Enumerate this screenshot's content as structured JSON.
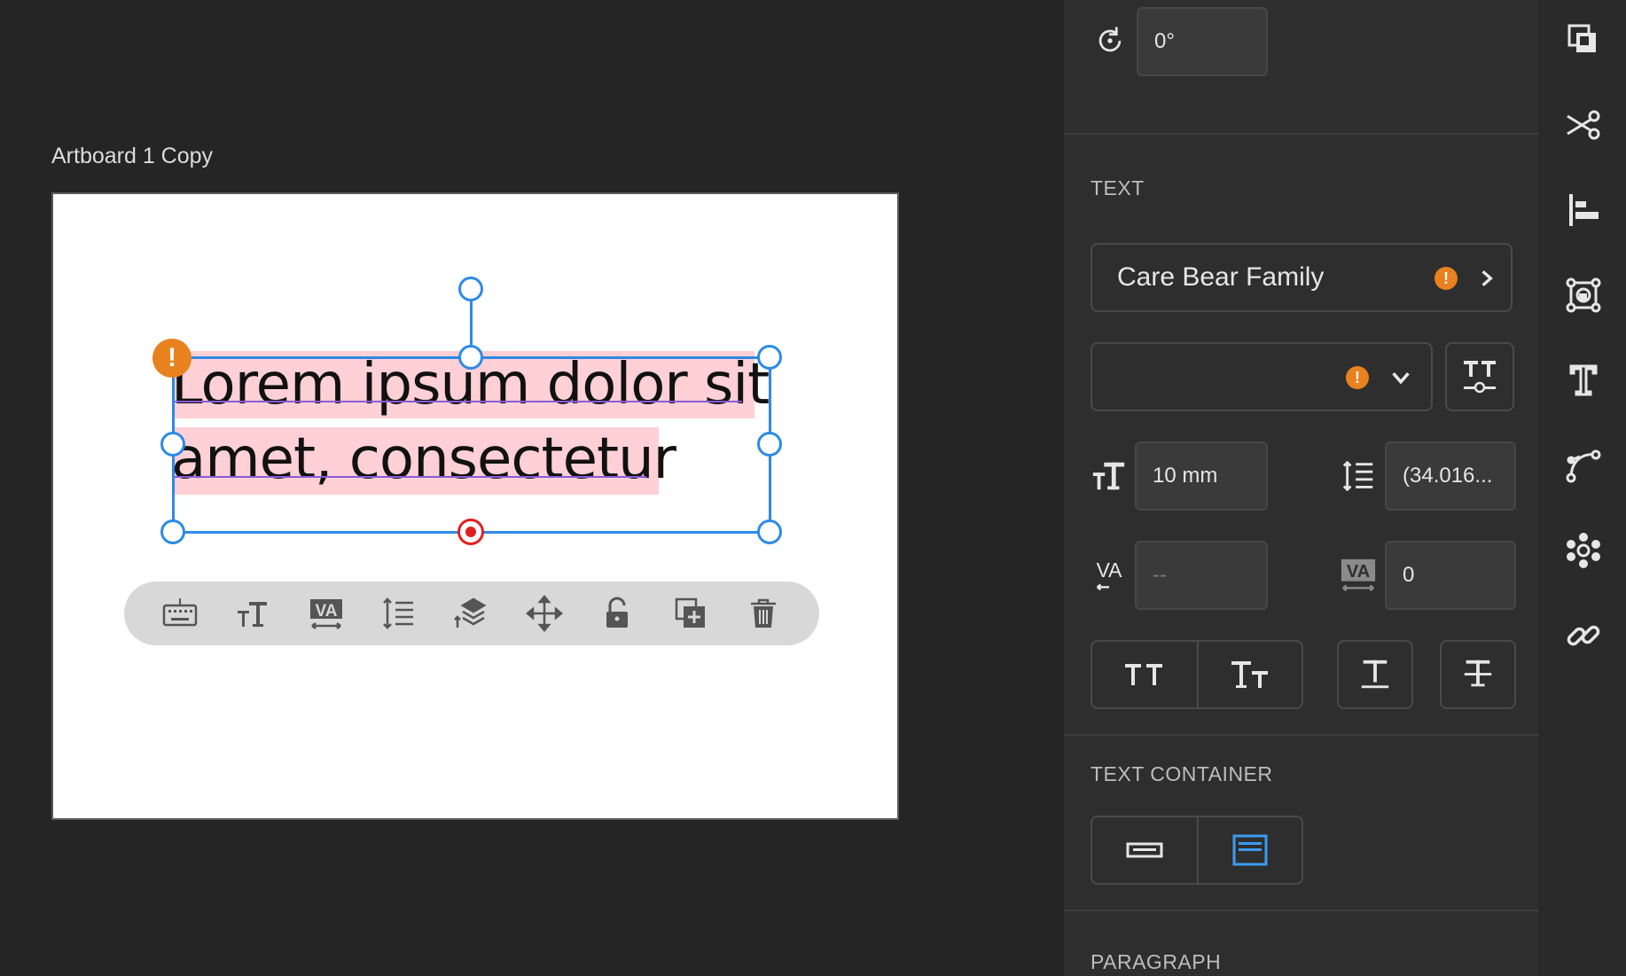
{
  "canvas": {
    "artboard_name": "Artboard 1 Copy",
    "text_lines": [
      "Lorem ipsum dolor sit",
      "amet, consectetur"
    ],
    "warning_glyph": "!",
    "toolbar_icons": [
      "keyboard-icon",
      "font-size-icon",
      "kerning-icon",
      "line-spacing-icon",
      "arrange-icon",
      "move-icon",
      "unlock-icon",
      "duplicate-icon",
      "delete-icon"
    ]
  },
  "panel": {
    "rotation": {
      "value": "0°",
      "icon": "rotate-icon"
    },
    "text_section": {
      "title": "TEXT",
      "font_family": "Care Bear Family",
      "font_style": "",
      "font_size": "10 mm",
      "line_spacing": "(34.016...",
      "kerning": "--",
      "tracking": "0"
    },
    "text_container_section": {
      "title": "TEXT CONTAINER"
    },
    "paragraph_section": {
      "title": "PARAGRAPH"
    }
  },
  "rail": {
    "icons": [
      "layers-icon",
      "cut-icon",
      "align-icon",
      "transform-icon",
      "text-icon",
      "path-icon",
      "pattern-icon",
      "link-icon"
    ]
  },
  "colors": {
    "selection": "#2d8ae6",
    "warning": "#e8821e",
    "text_highlight": "#ffd0d6",
    "active_icon": "#3b9cf0"
  }
}
